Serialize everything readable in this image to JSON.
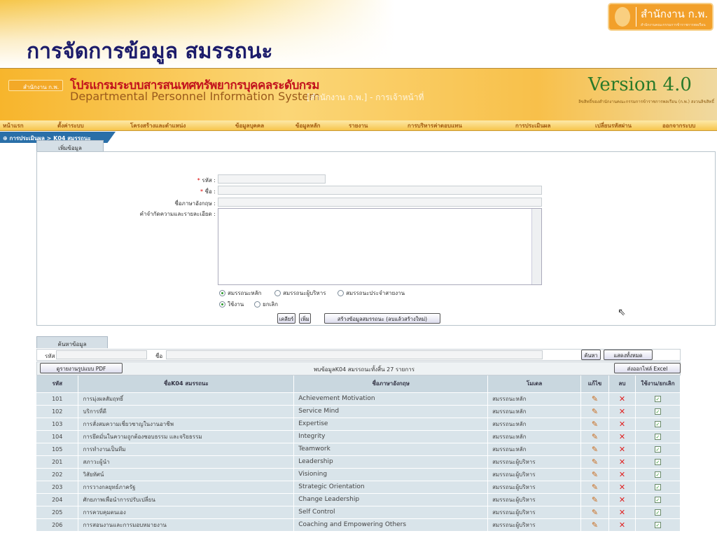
{
  "slide_title": "การจัดการข้อมูล สมรรถนะ",
  "corner_logo": {
    "title": "สำนักงาน ก.พ.",
    "subtitle": "สำนักงานคณะกรรมการข้าราชการพลเรือน"
  },
  "app_header": {
    "mini_logo": "สำนักงาน ก.พ.",
    "title_th": "โปรแกรมระบบสารสนเทศทรัพยากรบุคคลระดับกรม",
    "title_en": "Departmental Personnel Information System",
    "role": "[สำนักงาน ก.พ.] - การเจ้าหน้าที่",
    "version": "Version 4.0",
    "copyright": "ลิขสิทธิ์ของสำนักงานคณะกรรมการข้าราชการพลเรือน (ก.พ.) สงวนลิขสิทธิ์"
  },
  "nav": [
    "หน้าแรก",
    "ตั้งค่าระบบ",
    "โครงสร้างและตำแหน่ง",
    "ข้อมูลบุคคล",
    "ข้อมูลหลัก",
    "รายงาน",
    "การบริหารค่าตอบแทน",
    "การประเมินผล",
    "เปลี่ยนรหัสผ่าน",
    "ออกจากระบบ"
  ],
  "breadcrumb": "⊕ การประเมินผล > K04 สมรรถนะ",
  "add_form": {
    "tab": "เพิ่มข้อมูล",
    "code_label": "รหัส :",
    "name_label": "ชื่อ :",
    "en_label": "ชื่อภาษาอังกฤษ :",
    "desc_label": "คำจำกัดความและรายละเอียด :",
    "code": "",
    "name": "",
    "en": "",
    "desc": "",
    "type_options": [
      "สมรรถนะหลัก",
      "สมรรถนะผู้บริหาร",
      "สมรรถนะประจำสายงาน"
    ],
    "type_selected": 0,
    "status_options": [
      "ใช้งาน",
      "ยกเลิก"
    ],
    "status_selected": 0,
    "clear": "เคลียร์",
    "add": "เพิ่ม",
    "rebuild": "สร้างข้อมูลสมรรถนะ (ลบแล้วสร้างใหม่)"
  },
  "search": {
    "tab": "ค้นหาข้อมูล",
    "code_label": "รหัส",
    "name_label": "ชื่อ",
    "code": "",
    "name": "",
    "search": "ค้นหา",
    "show_all": "แสดงทั้งหมด",
    "pdf": "ดูรายงานรูปแบบ PDF",
    "summary": "พบข้อมูลK04 สมรรถนะทั้งสิ้น 27 รายการ",
    "excel": "ส่งออกไฟล์ Excel"
  },
  "table": {
    "headers": [
      "รหัส",
      "ชื่อK04 สมรรถนะ",
      "ชื่อภาษาอังกฤษ",
      "โมเดล",
      "แก้ไข",
      "ลบ",
      "ใช้งาน/ยกเลิก"
    ],
    "rows": [
      [
        "101",
        "การมุ่งผลสัมฤทธิ์",
        "Achievement Motivation",
        "สมรรถนะหลัก"
      ],
      [
        "102",
        "บริการที่ดี",
        "Service Mind",
        "สมรรถนะหลัก"
      ],
      [
        "103",
        "การสั่งสมความเชี่ยวชาญในงานอาชีพ",
        "Expertise",
        "สมรรถนะหลัก"
      ],
      [
        "104",
        "การยึดมั่นในความถูกต้องชอบธรรม และจริยธรรม",
        "Integrity",
        "สมรรถนะหลัก"
      ],
      [
        "105",
        "การทำงานเป็นทีม",
        "Teamwork",
        "สมรรถนะหลัก"
      ],
      [
        "201",
        "สภาวะผู้นำ",
        "Leadership",
        "สมรรถนะผู้บริหาร"
      ],
      [
        "202",
        "วิสัยทัศน์",
        "Visioning",
        "สมรรถนะผู้บริหาร"
      ],
      [
        "203",
        "การวางกลยุทธ์ภาครัฐ",
        "Strategic Orientation",
        "สมรรถนะผู้บริหาร"
      ],
      [
        "204",
        "ศักยภาพเพื่อนำการปรับเปลี่ยน",
        "Change Leadership",
        "สมรรถนะผู้บริหาร"
      ],
      [
        "205",
        "การควบคุมตนเอง",
        "Self Control",
        "สมรรถนะผู้บริหาร"
      ],
      [
        "206",
        "การสอนงานและการมอบหมายงาน",
        "Coaching and Empowering Others",
        "สมรรถนะผู้บริหาร"
      ]
    ]
  }
}
